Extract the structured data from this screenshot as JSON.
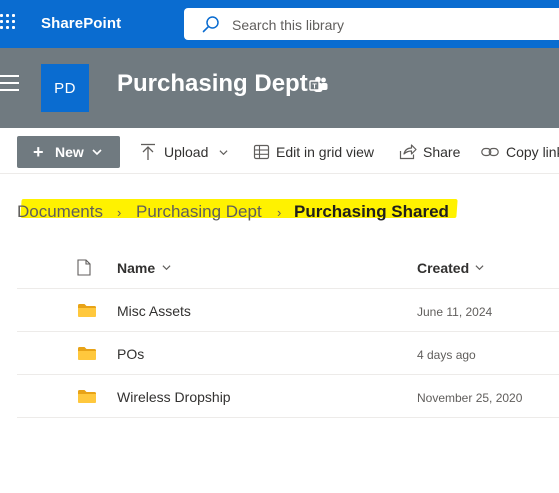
{
  "suite_bar": {
    "app_name": "SharePoint",
    "search_placeholder": "Search this library",
    "brand_color": "#0a6cd0"
  },
  "site_header": {
    "logo_initials": "PD",
    "site_title": "Purchasing Dept",
    "header_color": "#707a80"
  },
  "command_bar": {
    "new_label": "New",
    "upload_label": "Upload",
    "grid_view_label": "Edit in grid view",
    "share_label": "Share",
    "copy_link_label": "Copy link"
  },
  "breadcrumb": {
    "items": [
      "Documents",
      "Purchasing Dept",
      "Purchasing Shared"
    ],
    "highlight_color": "#fff200"
  },
  "list": {
    "columns": {
      "name": "Name",
      "created": "Created"
    },
    "rows": [
      {
        "name": "Misc Assets",
        "created": "June 11, 2024",
        "icon": "folder-icon"
      },
      {
        "name": "POs",
        "created": "4 days ago",
        "icon": "folder-icon"
      },
      {
        "name": "Wireless Dropship",
        "created": "November 25, 2020",
        "icon": "folder-icon"
      }
    ]
  }
}
